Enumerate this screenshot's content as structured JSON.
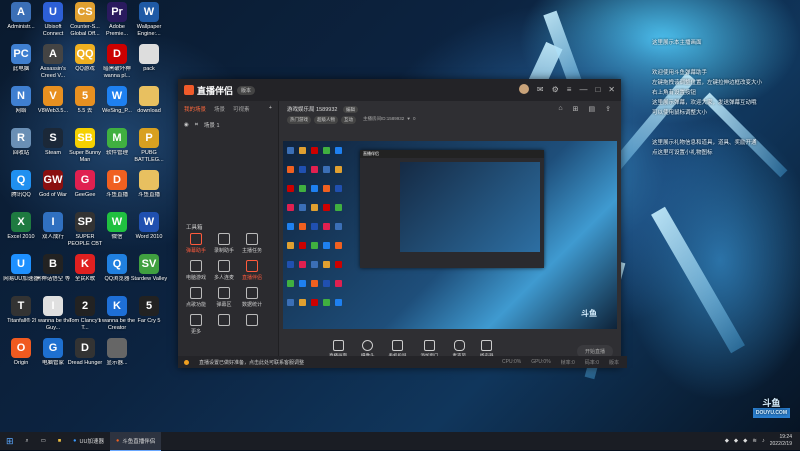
{
  "desktop": {
    "icons": [
      {
        "label": "Administr...",
        "color": "#3b6fb6",
        "glyph": "A"
      },
      {
        "label": "Ubisoft Connect",
        "color": "#2d5fd6",
        "glyph": "U"
      },
      {
        "label": "Counter-S... Global Off...",
        "color": "#e0a030",
        "glyph": "CS"
      },
      {
        "label": "Adobe Premie...",
        "color": "#2a1a5e",
        "glyph": "Pr"
      },
      {
        "label": "Wallpaper Engine:...",
        "color": "#1f5aa6",
        "glyph": "W"
      },
      {
        "label": "此电脑",
        "color": "#3f7fd0",
        "glyph": "PC"
      },
      {
        "label": "Assassin's Creed V...",
        "color": "#444",
        "glyph": "A"
      },
      {
        "label": "QQ游戏",
        "color": "#f0b020",
        "glyph": "QQ"
      },
      {
        "label": "暗黑破坏神 wanna pl...",
        "color": "#c00",
        "glyph": "D"
      },
      {
        "label": "pack",
        "color": "#ddd",
        "glyph": ""
      },
      {
        "label": "网络",
        "color": "#3f7fd0",
        "glyph": "N"
      },
      {
        "label": "V8Web3.5...",
        "color": "#e89020",
        "glyph": "V"
      },
      {
        "label": "5.5 去",
        "color": "#e89020",
        "glyph": "5"
      },
      {
        "label": "WeSing_P...",
        "color": "#1e80f0",
        "glyph": "W"
      },
      {
        "label": "download",
        "color": "#e8c060",
        "glyph": ""
      },
      {
        "label": "回收站",
        "color": "#6a8fb5",
        "glyph": "R"
      },
      {
        "label": "Steam",
        "color": "#1b2838",
        "glyph": "S"
      },
      {
        "label": "Super Bunny Man",
        "color": "#f5d000",
        "glyph": "SB"
      },
      {
        "label": "软件管理",
        "color": "#40b040",
        "glyph": "M"
      },
      {
        "label": "PUBG BATTLEG...",
        "color": "#d8a020",
        "glyph": "P"
      },
      {
        "label": "腾讯QQ",
        "color": "#2090f0",
        "glyph": "Q"
      },
      {
        "label": "God of War",
        "color": "#8a1010",
        "glyph": "GW"
      },
      {
        "label": "GeeGee",
        "color": "#e02050",
        "glyph": "G"
      },
      {
        "label": "斗鱼直播",
        "color": "#f06020",
        "glyph": "D"
      },
      {
        "label": "斗鱼直播",
        "color": "#e8c060",
        "glyph": ""
      },
      {
        "label": "Excel 2010",
        "color": "#1e7a40",
        "glyph": "X"
      },
      {
        "label": "双人成行",
        "color": "#3070c0",
        "glyph": "I"
      },
      {
        "label": "SUPER PEOPLE CBT",
        "color": "#333",
        "glyph": "SP"
      },
      {
        "label": "微信",
        "color": "#20c040",
        "glyph": "W"
      },
      {
        "label": "Word 2010",
        "color": "#2050b0",
        "glyph": "W"
      },
      {
        "label": "网易UU加速器",
        "color": "#1e90ff",
        "glyph": "U"
      },
      {
        "label": "黑神话悟空 等",
        "color": "#222",
        "glyph": "B"
      },
      {
        "label": "全民K歌",
        "color": "#e02020",
        "glyph": "K"
      },
      {
        "label": "QQ浏览器",
        "color": "#2080e0",
        "glyph": "Q"
      },
      {
        "label": "Stardew Valley",
        "color": "#40a040",
        "glyph": "SV"
      },
      {
        "label": "Titanfall® 2",
        "color": "#333",
        "glyph": "T"
      },
      {
        "label": "I wanna be the Guy...",
        "color": "#e0e0e0",
        "glyph": "I"
      },
      {
        "label": "Tom Clancy's T...",
        "color": "#222",
        "glyph": "2"
      },
      {
        "label": "I wanna be the Creator",
        "color": "#1e6fd6",
        "glyph": "K"
      },
      {
        "label": "Far Cry 5",
        "color": "#222",
        "glyph": "5"
      },
      {
        "label": "Origin",
        "color": "#f05a20",
        "glyph": "O"
      },
      {
        "label": "电脑管家",
        "color": "#1e70d0",
        "glyph": "G"
      },
      {
        "label": "Dread Hunger",
        "color": "#333",
        "glyph": "D"
      },
      {
        "label": "显示器...",
        "color": "#666",
        "glyph": ""
      }
    ],
    "right_notes": [
      "这里展示本主播画面",
      "",
      "",
      "欢迎使用斗鱼弹幕助手",
      "左键拖拽该调整位置，左键拉伸边框改变大小",
      "右上角有设置按钮",
      "这里展示弹幕，欢迎大家，发送弹幕互动哦",
      "可以使用鼠标调整大小",
      "",
      "",
      "这里展示礼物信息和道具，道具、奖励开通",
      "点这里可设置小礼物图标"
    ],
    "watermark": {
      "brand": "斗鱼",
      "sub": "DOUYU.COM"
    }
  },
  "app": {
    "title": "直播伴侣",
    "version_badge": "版本",
    "left_tabs": [
      "我的场景",
      "场景",
      "可视素"
    ],
    "scene_label": "场景 1",
    "tools_header": "工具箱",
    "tools": [
      {
        "label": "弹幕助手",
        "red": true
      },
      {
        "label": "录制助手",
        "red": false
      },
      {
        "label": "主播任务",
        "red": false
      },
      {
        "label": "电脑游戏",
        "red": false
      },
      {
        "label": "多人连麦",
        "red": false
      },
      {
        "label": "直播伴侣",
        "red": true
      },
      {
        "label": "点歌功能",
        "red": false
      },
      {
        "label": "弹幕区",
        "red": false
      },
      {
        "label": "数据统计",
        "red": false
      },
      {
        "label": "更多",
        "red": false
      },
      {
        "label": "",
        "red": false
      },
      {
        "label": "",
        "red": false
      }
    ],
    "room": {
      "title": "游戏娱乐局 1589932",
      "edit": "编辑",
      "tags": [
        "热门游戏",
        "超级人物",
        "互动"
      ],
      "sub": "主播房间ID:1589932",
      "viewers": "0"
    },
    "controls": [
      "直播画面",
      "摄像头",
      "手机投屏",
      "添加窗口",
      "麦克风",
      "扬声器"
    ],
    "start_button": "开始直播",
    "status": {
      "notice": "直播设置已做好准备，点击此处可联系客服调整",
      "items": [
        "CPU:0%",
        "GPU:0%",
        "帧率:0",
        "码率:0"
      ],
      "right": "版本"
    }
  },
  "taskbar": {
    "items": [
      {
        "label": "UU加速器",
        "active": false
      },
      {
        "label": "斗鱼直播伴侣",
        "active": true
      }
    ],
    "time": "19:24",
    "date": "2022/2/19"
  }
}
